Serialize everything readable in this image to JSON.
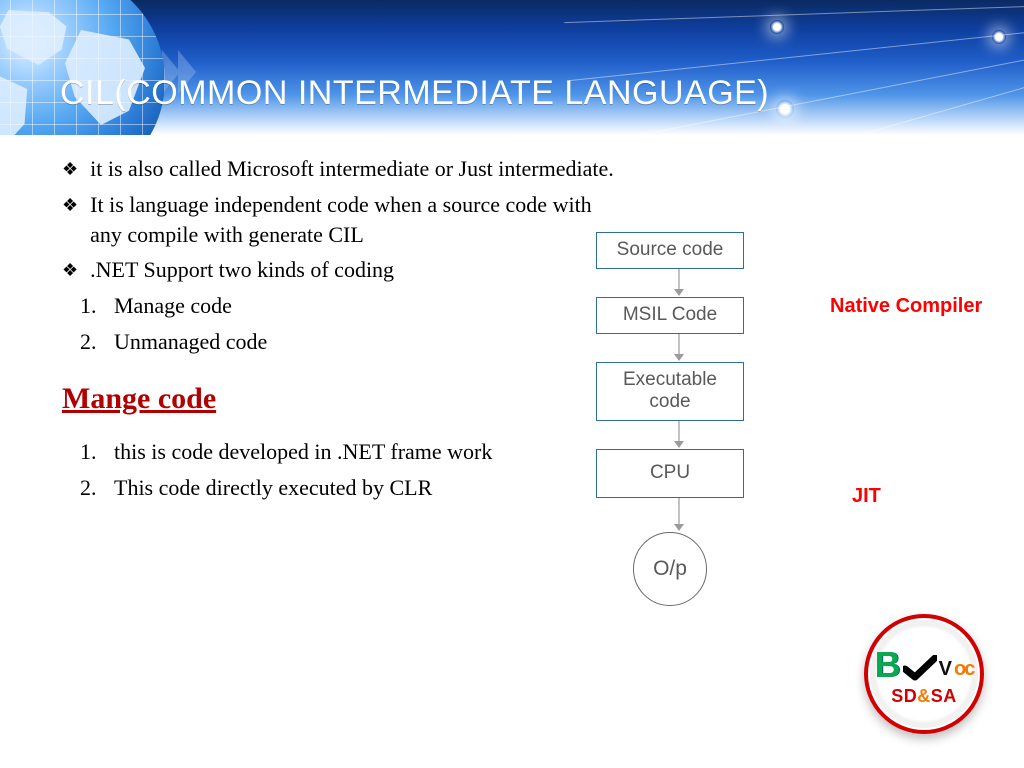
{
  "title": "CIL(COMMON INTERMEDIATE LANGUAGE)",
  "bullets": {
    "b1": "it is also called Microsoft intermediate or Just intermediate.",
    "b2": "It is language independent code when a source code with any compile with generate CIL",
    "b3": ".NET Support two kinds of coding"
  },
  "kinds": {
    "n1": "Manage code",
    "n2": "Unmanaged code"
  },
  "section": "Mange code",
  "manage": {
    "m1": "this is code developed in .NET frame work",
    "m2": "This code directly executed by CLR"
  },
  "flow": {
    "box1": "Source code",
    "box2": "MSIL Code",
    "box3": "Executable code",
    "box4": "CPU",
    "out": "O/p"
  },
  "labels": {
    "native_compiler": "Native Compiler",
    "jit": "JIT"
  },
  "logo": {
    "part_b": "B",
    "part_v": "V",
    "part_oc": "oc",
    "sd": "SD",
    "amp": "&",
    "sa": "SA"
  }
}
